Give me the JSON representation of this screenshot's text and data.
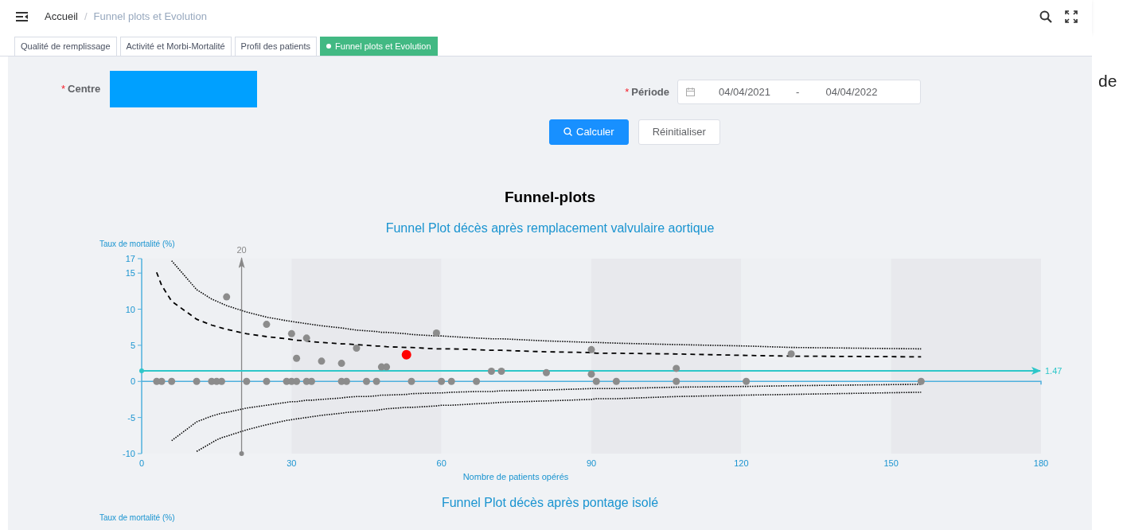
{
  "breadcrumb": [
    {
      "label": "Accueil",
      "current": false
    },
    {
      "label": "Funnel plots et Evolution",
      "current": true
    }
  ],
  "breadcrumb_separator": "/",
  "tabs": [
    {
      "label": "Qualité de remplissage",
      "selected": false
    },
    {
      "label": "Activité et Morbi-Mortalité",
      "selected": false
    },
    {
      "label": "Profil des patients",
      "selected": false
    },
    {
      "label": "Funnel plots et Evolution",
      "selected": true
    }
  ],
  "form": {
    "centre": {
      "label": "Centre",
      "required_mark": "*",
      "color": "#00a0ff"
    },
    "periode": {
      "label": "Période",
      "required_mark": "*",
      "start": "04/04/2021",
      "separator": "-",
      "end": "04/04/2022"
    },
    "buttons": [
      {
        "label": "Calculer",
        "kind": "primary"
      },
      {
        "label": "Réinitialiser",
        "kind": "default"
      }
    ]
  },
  "side_text": "de",
  "section_title": "Funnel-plots",
  "charts": [
    {
      "title": "Funnel Plot décès après remplacement valvulaire aortique",
      "chart_data": {
        "type": "scatter",
        "xlabel": "Nombre de patients opérés",
        "ylabel": "Taux de mortalité (%)",
        "xlim": [
          0,
          180
        ],
        "ylim": [
          -10,
          17
        ],
        "xticks": [
          0,
          30,
          60,
          90,
          120,
          150,
          180
        ],
        "yticks": [
          -10,
          -5,
          0,
          5,
          10,
          15,
          17
        ],
        "x": [
          3,
          4,
          6,
          11,
          14,
          15,
          16,
          17,
          21,
          25,
          29,
          30,
          31,
          33,
          34,
          36,
          40,
          41,
          43,
          45,
          47,
          48,
          49,
          53,
          54,
          59,
          60,
          62,
          67,
          70,
          72,
          81,
          90,
          91,
          95,
          107,
          121,
          130,
          156
        ],
        "series": [
          {
            "color": "#8c8c8c",
            "values": [
              0,
              0,
              0,
              0,
              0,
              0,
              0,
              null,
              0,
              0,
              0,
              0,
              0,
              0,
              0,
              null,
              0,
              0,
              null,
              0,
              0,
              null,
              null,
              null,
              0,
              null,
              0,
              0,
              0,
              null,
              null,
              null,
              null,
              0,
              0,
              0,
              0,
              null,
              0
            ]
          },
          {
            "color": "#8c8c8c",
            "values": [
              null,
              null,
              null,
              null,
              null,
              null,
              null,
              11.7,
              null,
              7.9,
              null,
              6.6,
              3.2,
              6,
              null,
              2.8,
              2.5,
              null,
              4.6,
              null,
              null,
              2,
              2,
              null,
              null,
              6.7,
              null,
              null,
              null,
              1.4,
              1.4,
              1.2,
              4.4,
              null,
              null,
              1.8,
              null,
              3.8,
              null
            ]
          },
          {
            "color": "#8c8c8c",
            "values": [
              null,
              null,
              null,
              null,
              null,
              null,
              null,
              null,
              null,
              null,
              null,
              null,
              null,
              null,
              null,
              null,
              null,
              null,
              null,
              null,
              null,
              null,
              null,
              null,
              null,
              null,
              null,
              null,
              null,
              null,
              null,
              null,
              1,
              null,
              null,
              null,
              null,
              null,
              null
            ]
          },
          {
            "color": "#ff0000",
            "values": [
              null,
              null,
              null,
              null,
              null,
              null,
              null,
              null,
              null,
              null,
              null,
              null,
              null,
              null,
              null,
              null,
              null,
              null,
              null,
              null,
              null,
              null,
              null,
              3.7,
              null,
              null,
              null,
              null,
              null,
              null,
              null,
              null,
              null,
              null,
              null,
              null,
              null,
              null,
              null
            ]
          },
          {
            "type": "line",
            "line_style": "dotted",
            "color": "#000000",
            "values": [
              null,
              null,
              16.7,
              12.7,
              11.4,
              11.1,
              10.8,
              10.5,
              9.6,
              8.9,
              8.4,
              8.3,
              8.2,
              8,
              7.9,
              7.7,
              7.4,
              7.3,
              7.1,
              7,
              6.9,
              6.8,
              6.8,
              6.6,
              6.5,
              6.3,
              6.3,
              6.2,
              6,
              5.9,
              5.9,
              5.6,
              5.4,
              5.4,
              5.3,
              5.1,
              4.9,
              4.7,
              4.5
            ]
          },
          {
            "type": "line",
            "line_style": "dashed",
            "color": "#000000",
            "values": [
              15.1,
              13.3,
              11.1,
              8.6,
              7.8,
              7.6,
              7.4,
              7.2,
              6.6,
              6.2,
              5.9,
              5.8,
              5.7,
              5.6,
              5.5,
              5.4,
              5.2,
              5.2,
              5.1,
              5,
              4.9,
              4.9,
              4.8,
              4.7,
              4.7,
              4.5,
              4.5,
              4.5,
              4.4,
              4.3,
              4.3,
              4.1,
              4,
              3.9,
              3.9,
              3.8,
              3.6,
              3.5,
              3.4
            ]
          },
          {
            "type": "line",
            "line_style": "dotted",
            "color": "#000000",
            "values": [
              null,
              null,
              -8.2,
              -5.6,
              -4.8,
              -4.6,
              -4.4,
              -4.3,
              -3.7,
              -3.3,
              -2.9,
              -2.8,
              -2.8,
              -2.6,
              -2.6,
              -2.5,
              -2.3,
              -2.2,
              -2.1,
              -2.1,
              -2,
              -1.9,
              -1.9,
              -1.8,
              -1.7,
              -1.6,
              -1.6,
              -1.5,
              -1.4,
              -1.4,
              -1.3,
              -1.2,
              -1,
              -1,
              -1,
              -0.8,
              -0.7,
              -0.6,
              -0.4
            ]
          },
          {
            "type": "line",
            "line_style": "dotted",
            "color": "#000000",
            "values": [
              null,
              null,
              null,
              -9.7,
              -8.5,
              -8.1,
              -7.8,
              -7.6,
              -6.7,
              -6,
              -5.4,
              -5.3,
              -5.2,
              -5,
              -4.9,
              -4.7,
              -4.4,
              -4.3,
              -4.2,
              -4.1,
              -4,
              -3.9,
              -3.8,
              -3.6,
              -3.6,
              -3.4,
              -3.3,
              -3.3,
              -3.1,
              -3,
              -2.9,
              -2.7,
              -2.5,
              -2.4,
              -2.4,
              -2.1,
              -1.9,
              -1.8,
              -1.5
            ]
          }
        ],
        "ref_lines": [
          {
            "axis": "x",
            "value": 20,
            "label": "20",
            "color": "#888888"
          },
          {
            "axis": "y",
            "value": 1.47,
            "label": "1.47",
            "color": "#2ec7c9"
          }
        ]
      }
    },
    {
      "title": "Funnel Plot décès après pontage isolé",
      "ylabel": "Taux de mortalité (%)"
    }
  ]
}
